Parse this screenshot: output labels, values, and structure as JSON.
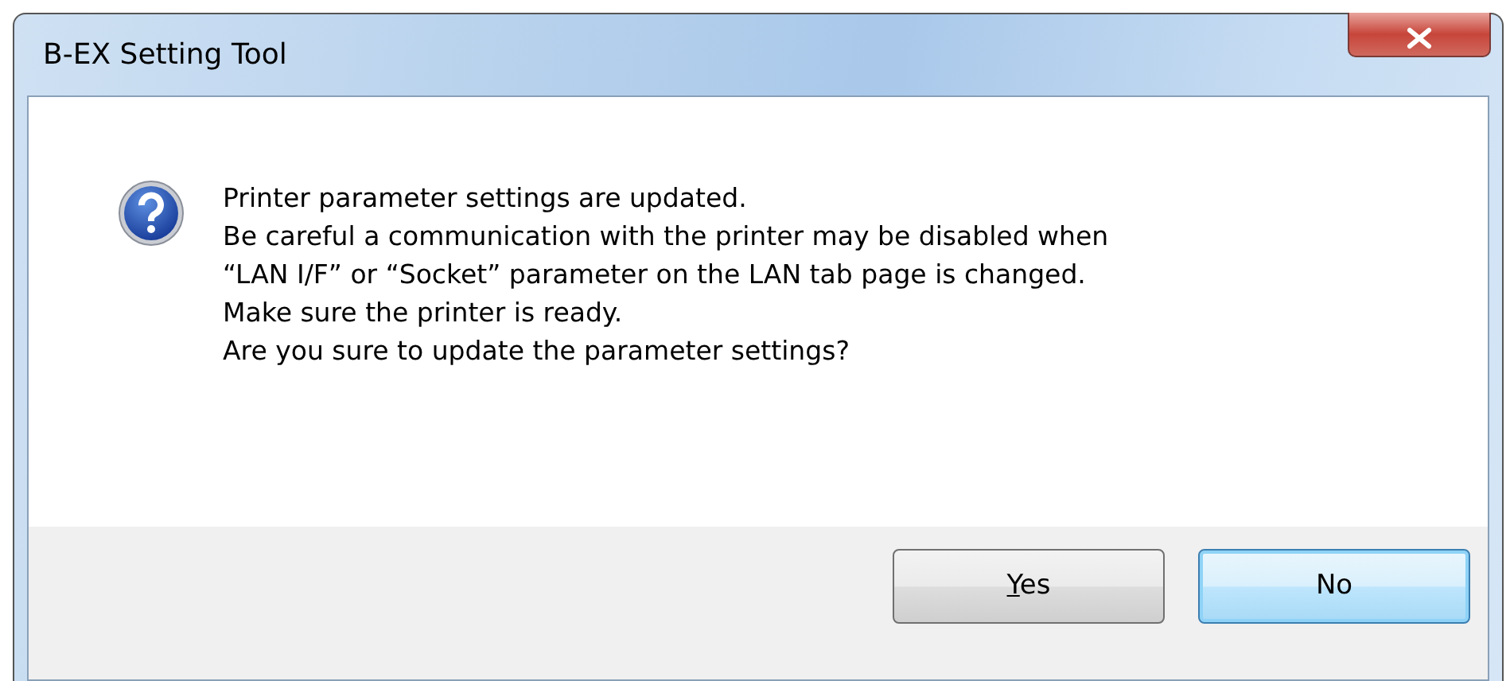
{
  "window": {
    "title": "B-EX Setting Tool"
  },
  "message": [
    "Printer parameter settings are updated.",
    "Be careful a communication with the printer may be disabled when",
    "“LAN I/F” or “Socket” parameter on the LAN tab page is changed.",
    "Make sure the printer is ready.",
    "Are you sure to update the parameter settings?"
  ],
  "buttons": [
    {
      "label": "Yes",
      "mnemonic": true,
      "default": false
    },
    {
      "label": "No",
      "mnemonic": false,
      "default": true
    }
  ]
}
